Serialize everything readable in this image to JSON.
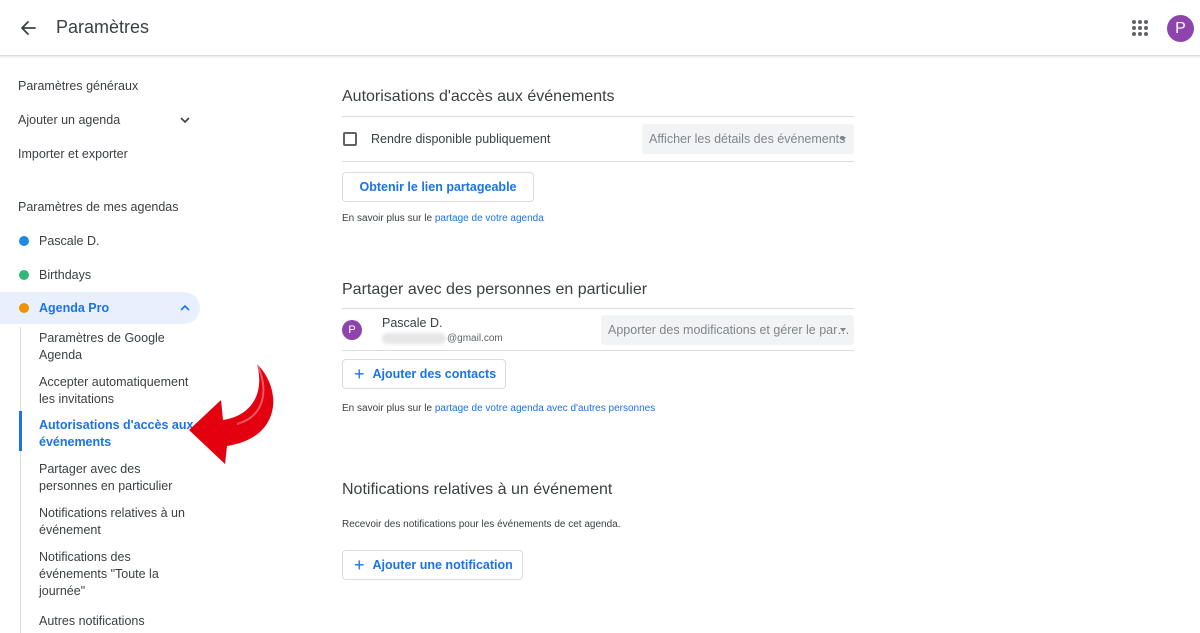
{
  "header": {
    "title": "Paramètres",
    "avatar_initial": "P"
  },
  "sidebar": {
    "general_settings": "Paramètres généraux",
    "add_calendar": "Ajouter un agenda",
    "import_export": "Importer et exporter",
    "my_calendars_heading": "Paramètres de mes agendas",
    "calendars": [
      {
        "label": "Pascale D.",
        "color": "#1e88e5"
      },
      {
        "label": "Birthdays",
        "color": "#33b679"
      },
      {
        "label": "Agenda Pro",
        "color": "#f09300"
      }
    ],
    "sub_items": [
      {
        "label": "Paramètres de Google Agenda"
      },
      {
        "label": "Accepter automatiquement les invitations"
      },
      {
        "label": "Autorisations d'accès aux événements"
      },
      {
        "label": "Partager avec des personnes en particulier"
      },
      {
        "label": "Notifications relatives à un événement"
      },
      {
        "label": "Notifications des événements \"Toute la journée\""
      },
      {
        "label": "Autres notifications"
      }
    ]
  },
  "access": {
    "title": "Autorisations d'accès aux événements",
    "public_checkbox_label": "Rendre disponible publiquement",
    "public_checked": false,
    "detail_select_value": "Afficher les détails des événements",
    "share_link_button": "Obtenir le lien partageable",
    "hint_prefix": "En savoir plus sur le ",
    "hint_link": "partage de votre agenda"
  },
  "share": {
    "title": "Partager avec des personnes en particulier",
    "person": {
      "avatar_initial": "P",
      "name": "Pascale D.",
      "email_suffix": "@gmail.com",
      "permission": "Apporter des modifications et gérer le par…"
    },
    "add_contacts_button": "Ajouter des contacts",
    "hint_prefix": "En savoir plus sur le ",
    "hint_link": "partage de votre agenda avec d'autres personnes"
  },
  "notifications": {
    "title": "Notifications relatives à un événement",
    "description": "Recevoir des notifications pour les événements de cet agenda.",
    "add_notification_button": "Ajouter une notification"
  },
  "colors": {
    "accent": "#1a73e8",
    "avatar": "#8e44ad",
    "annotation_arrow": "#e3000f"
  }
}
